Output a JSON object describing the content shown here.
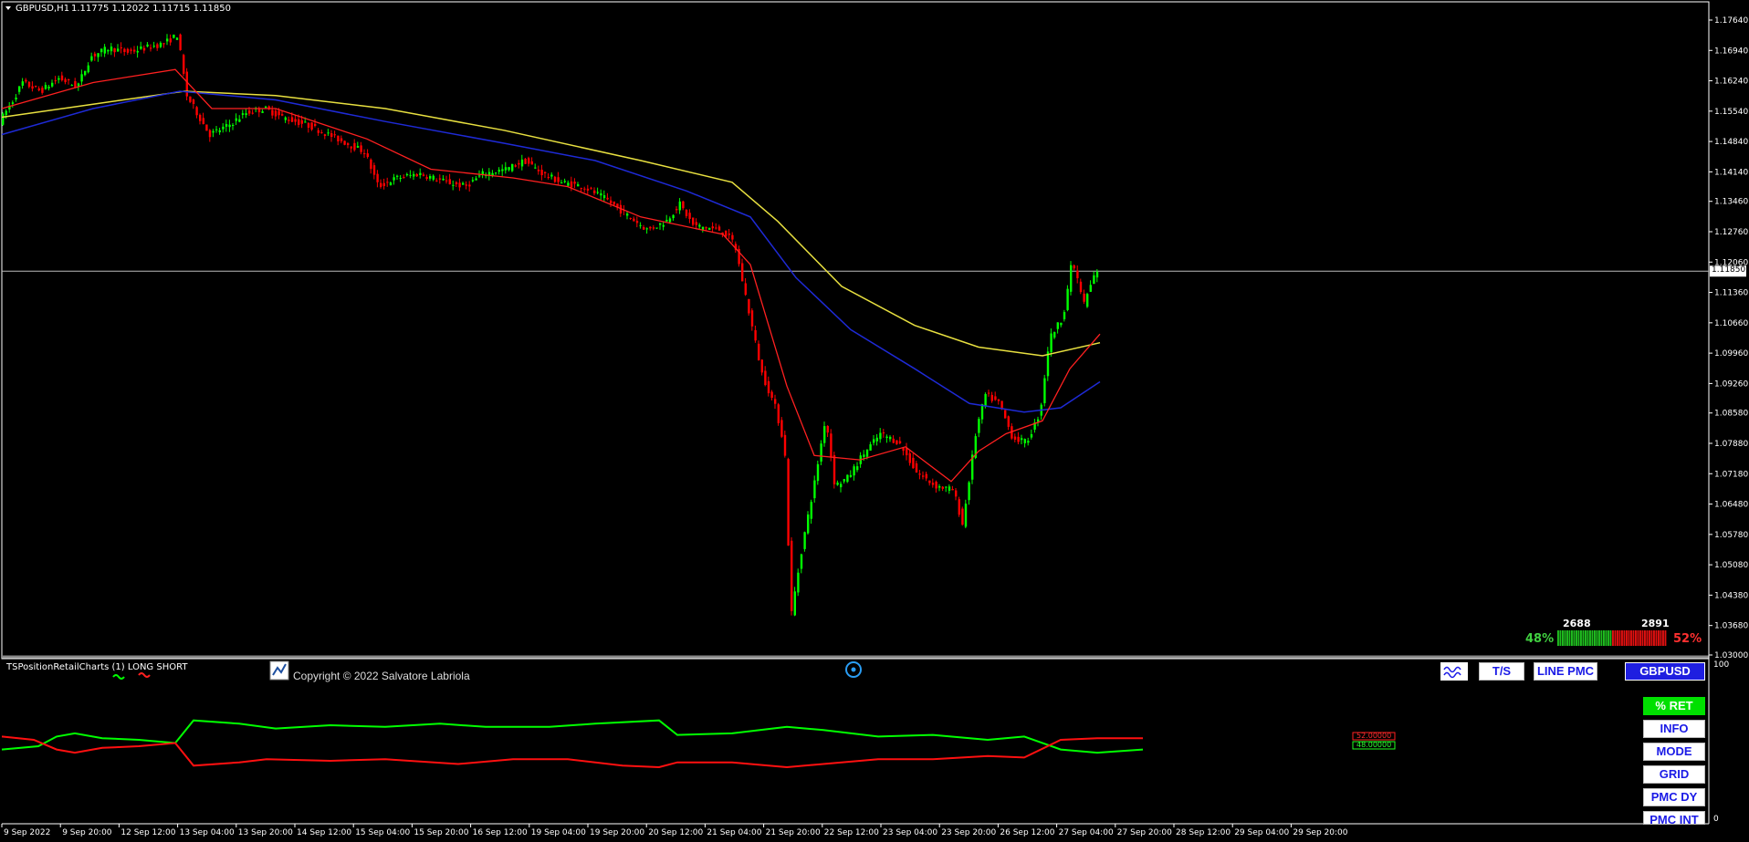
{
  "header": {
    "symbol_tf": "GBPUSD,H1",
    "ohlc": "1.11775 1.12022 1.11715 1.11850"
  },
  "price_axis": {
    "ticks": [
      "1.17640",
      "1.16940",
      "1.16240",
      "1.15540",
      "1.14840",
      "1.14140",
      "1.13460",
      "1.12760",
      "1.12060",
      "1.11360",
      "1.10660",
      "1.09960",
      "1.09260",
      "1.08580",
      "1.07880",
      "1.07180",
      "1.06480",
      "1.05780",
      "1.05080",
      "1.04380",
      "1.03680",
      "1.03000"
    ],
    "range": [
      1.03,
      1.1764
    ],
    "current_price": "1.11850",
    "current_value": 1.1185
  },
  "time_axis": {
    "labels": [
      "9 Sep 2022",
      "9 Sep 20:00",
      "12 Sep 12:00",
      "13 Sep 04:00",
      "13 Sep 20:00",
      "14 Sep 12:00",
      "15 Sep 04:00",
      "15 Sep 20:00",
      "16 Sep 12:00",
      "19 Sep 04:00",
      "19 Sep 20:00",
      "20 Sep 12:00",
      "21 Sep 04:00",
      "21 Sep 20:00",
      "22 Sep 12:00",
      "23 Sep 04:00",
      "23 Sep 20:00",
      "26 Sep 12:00",
      "27 Sep 04:00",
      "27 Sep 20:00",
      "28 Sep 12:00",
      "29 Sep 04:00",
      "29 Sep 20:00"
    ]
  },
  "sentiment": {
    "long_count": "2688",
    "short_count": "2891",
    "long_pct": "48%",
    "short_pct": "52%",
    "long_fraction": 0.48
  },
  "indicator": {
    "name": "TSPositionRetailCharts (1) LONG SHORT",
    "copyright": "Copyright © 2022 Salvatore Labriola",
    "scale_top": "100",
    "scale_bottom": "0",
    "value_red": "52.00000",
    "value_green": "48.00000"
  },
  "toolbar": {
    "ts_label": "T/S",
    "line_pmc_label": "LINE PMC",
    "symbol_label": "GBPUSD"
  },
  "side_menu": {
    "ret_label": "% RET",
    "info_label": "INFO",
    "mode_label": "MODE",
    "grid_label": "GRID",
    "pmc_dy_label": "PMC DY",
    "pmc_int_label": "PMC INT"
  },
  "colors": {
    "bull": "#00ff00",
    "bear": "#ff0000",
    "ma_fast": "#ff2020",
    "ma_mid": "#1e2ad6",
    "ma_slow": "#e8e040",
    "long_line": "#00ff00",
    "short_line": "#ff1010"
  },
  "chart_data": {
    "type": "candlestick",
    "price_path": [
      [
        0,
        1.153
      ],
      [
        15,
        1.158
      ],
      [
        25,
        1.162
      ],
      [
        45,
        1.16
      ],
      [
        65,
        1.163
      ],
      [
        85,
        1.161
      ],
      [
        100,
        1.168
      ],
      [
        120,
        1.17
      ],
      [
        140,
        1.169
      ],
      [
        160,
        1.17
      ],
      [
        180,
        1.171
      ],
      [
        195,
        1.173
      ],
      [
        205,
        1.159
      ],
      [
        230,
        1.15
      ],
      [
        250,
        1.152
      ],
      [
        270,
        1.155
      ],
      [
        290,
        1.156
      ],
      [
        310,
        1.154
      ],
      [
        340,
        1.152
      ],
      [
        370,
        1.149
      ],
      [
        400,
        1.146
      ],
      [
        415,
        1.138
      ],
      [
        435,
        1.14
      ],
      [
        460,
        1.141
      ],
      [
        490,
        1.139
      ],
      [
        510,
        1.138
      ],
      [
        530,
        1.141
      ],
      [
        555,
        1.142
      ],
      [
        575,
        1.144
      ],
      [
        595,
        1.141
      ],
      [
        615,
        1.139
      ],
      [
        640,
        1.138
      ],
      [
        665,
        1.135
      ],
      [
        690,
        1.131
      ],
      [
        710,
        1.128
      ],
      [
        730,
        1.13
      ],
      [
        745,
        1.134
      ],
      [
        760,
        1.129
      ],
      [
        790,
        1.128
      ],
      [
        805,
        1.125
      ],
      [
        820,
        1.11
      ],
      [
        835,
        1.095
      ],
      [
        850,
        1.087
      ],
      [
        860,
        1.078
      ],
      [
        867,
        1.039
      ],
      [
        880,
        1.056
      ],
      [
        893,
        1.07
      ],
      [
        905,
        1.085
      ],
      [
        915,
        1.069
      ],
      [
        930,
        1.071
      ],
      [
        945,
        1.076
      ],
      [
        965,
        1.081
      ],
      [
        985,
        1.079
      ],
      [
        1005,
        1.072
      ],
      [
        1025,
        1.069
      ],
      [
        1045,
        1.068
      ],
      [
        1055,
        1.06
      ],
      [
        1070,
        1.082
      ],
      [
        1080,
        1.09
      ],
      [
        1095,
        1.088
      ],
      [
        1110,
        1.08
      ],
      [
        1125,
        1.079
      ],
      [
        1140,
        1.086
      ],
      [
        1150,
        1.103
      ],
      [
        1165,
        1.108
      ],
      [
        1175,
        1.121
      ],
      [
        1188,
        1.111
      ],
      [
        1200,
        1.118
      ]
    ],
    "ma_fast": [
      [
        0,
        1.156
      ],
      [
        100,
        1.162
      ],
      [
        190,
        1.165
      ],
      [
        230,
        1.156
      ],
      [
        300,
        1.156
      ],
      [
        400,
        1.149
      ],
      [
        470,
        1.142
      ],
      [
        560,
        1.14
      ],
      [
        620,
        1.138
      ],
      [
        700,
        1.131
      ],
      [
        790,
        1.127
      ],
      [
        820,
        1.12
      ],
      [
        860,
        1.092
      ],
      [
        890,
        1.076
      ],
      [
        940,
        1.075
      ],
      [
        990,
        1.078
      ],
      [
        1040,
        1.07
      ],
      [
        1070,
        1.077
      ],
      [
        1100,
        1.081
      ],
      [
        1140,
        1.084
      ],
      [
        1170,
        1.096
      ],
      [
        1203,
        1.104
      ]
    ],
    "ma_mid": [
      [
        0,
        1.15
      ],
      [
        100,
        1.156
      ],
      [
        195,
        1.16
      ],
      [
        300,
        1.158
      ],
      [
        420,
        1.153
      ],
      [
        550,
        1.148
      ],
      [
        650,
        1.144
      ],
      [
        750,
        1.137
      ],
      [
        820,
        1.131
      ],
      [
        870,
        1.117
      ],
      [
        930,
        1.105
      ],
      [
        1000,
        1.096
      ],
      [
        1060,
        1.088
      ],
      [
        1120,
        1.086
      ],
      [
        1160,
        1.087
      ],
      [
        1203,
        1.093
      ]
    ],
    "ma_slow": [
      [
        0,
        1.154
      ],
      [
        100,
        1.157
      ],
      [
        200,
        1.16
      ],
      [
        300,
        1.159
      ],
      [
        420,
        1.156
      ],
      [
        550,
        1.151
      ],
      [
        700,
        1.144
      ],
      [
        800,
        1.139
      ],
      [
        850,
        1.13
      ],
      [
        920,
        1.115
      ],
      [
        1000,
        1.106
      ],
      [
        1070,
        1.101
      ],
      [
        1140,
        1.099
      ],
      [
        1203,
        1.102
      ]
    ],
    "long_series": [
      [
        0,
        46
      ],
      [
        40,
        48
      ],
      [
        60,
        54
      ],
      [
        80,
        56
      ],
      [
        110,
        53
      ],
      [
        150,
        52
      ],
      [
        190,
        50
      ],
      [
        210,
        64
      ],
      [
        260,
        62
      ],
      [
        300,
        59
      ],
      [
        360,
        61
      ],
      [
        420,
        60
      ],
      [
        480,
        62
      ],
      [
        530,
        60
      ],
      [
        600,
        60
      ],
      [
        650,
        62
      ],
      [
        720,
        64
      ],
      [
        740,
        55
      ],
      [
        800,
        56
      ],
      [
        860,
        60
      ],
      [
        900,
        58
      ],
      [
        960,
        54
      ],
      [
        1020,
        55
      ],
      [
        1080,
        52
      ],
      [
        1120,
        54
      ],
      [
        1160,
        46
      ],
      [
        1200,
        44
      ],
      [
        1250,
        46
      ]
    ],
    "short_series": [
      [
        0,
        54
      ],
      [
        35,
        52
      ],
      [
        60,
        46
      ],
      [
        80,
        44
      ],
      [
        110,
        47
      ],
      [
        150,
        48
      ],
      [
        190,
        50
      ],
      [
        210,
        36
      ],
      [
        260,
        38
      ],
      [
        290,
        40
      ],
      [
        360,
        39
      ],
      [
        420,
        40
      ],
      [
        500,
        37
      ],
      [
        560,
        40
      ],
      [
        620,
        40
      ],
      [
        680,
        36
      ],
      [
        720,
        35
      ],
      [
        740,
        38
      ],
      [
        800,
        38
      ],
      [
        860,
        35
      ],
      [
        900,
        37
      ],
      [
        960,
        40
      ],
      [
        1020,
        40
      ],
      [
        1080,
        42
      ],
      [
        1120,
        41
      ],
      [
        1160,
        52
      ],
      [
        1200,
        53
      ],
      [
        1250,
        53
      ]
    ]
  }
}
